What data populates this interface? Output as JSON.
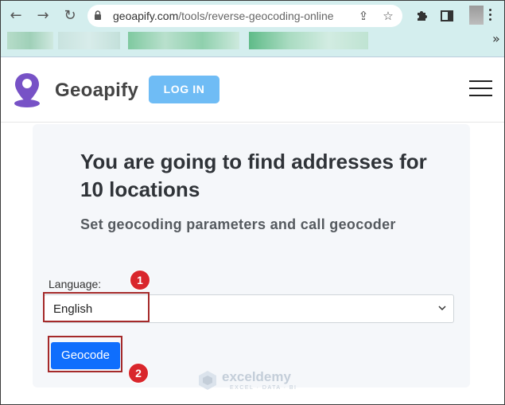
{
  "browser": {
    "url_host": "geoapify.com",
    "url_path": "/tools/reverse-geocoding-online",
    "more_bookmarks_icon": "chevron-double-right-icon"
  },
  "site": {
    "brand": "Geoapify",
    "login_label": "LOG IN",
    "brand_color": "#7752c6"
  },
  "main": {
    "heading": "You are going to find addresses for 10 locations",
    "subheading": "Set geocoding parameters and call geocoder",
    "language_label": "Language:",
    "language_value": "English",
    "geocode_label": "Geocode"
  },
  "annotations": {
    "badge_1": "1",
    "badge_2": "2",
    "highlight_color": "#a52a2a",
    "badge_color": "#d9262c"
  },
  "watermark": {
    "name": "exceldemy",
    "tagline": "EXCEL · DATA · BI"
  }
}
